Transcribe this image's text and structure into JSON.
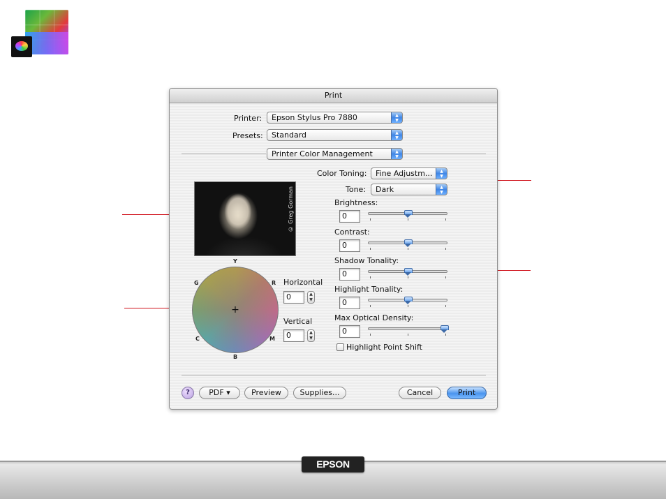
{
  "dialog": {
    "title": "Print",
    "printer_label": "Printer:",
    "printer_value": "Epson Stylus Pro 7880",
    "presets_label": "Presets:",
    "presets_value": "Standard",
    "panel_value": "Printer Color Management",
    "color_toning_label": "Color Toning:",
    "color_toning_value": "Fine Adjustm...",
    "tone_label": "Tone:",
    "tone_value": "Dark",
    "photo_credit": "© Greg Gorman",
    "wheel_labels": {
      "y": "Y",
      "r": "R",
      "m": "M",
      "b": "B",
      "c": "C",
      "g": "G"
    },
    "horizontal_label": "Horizontal",
    "horizontal_value": "0",
    "vertical_label": "Vertical",
    "vertical_value": "0",
    "sliders": [
      {
        "label": "Brightness:",
        "value": "0",
        "level": 0.5
      },
      {
        "label": "Contrast:",
        "value": "0",
        "level": 0.5
      },
      {
        "label": "Shadow Tonality:",
        "value": "0",
        "level": 0.5
      },
      {
        "label": "Highlight Tonality:",
        "value": "0",
        "level": 0.5
      },
      {
        "label": "Max Optical Density:",
        "value": "0",
        "level": 1.0
      }
    ],
    "highlight_point_shift_label": "Highlight Point Shift",
    "highlight_point_shift_checked": false,
    "help_label": "?",
    "pdf_label": "PDF ▾",
    "preview_label": "Preview",
    "supplies_label": "Supplies...",
    "cancel_label": "Cancel",
    "print_label": "Print"
  },
  "footer": {
    "brand": "EPSON"
  },
  "colors": {
    "callout": "#e0101a",
    "accent": "#4a94ee"
  },
  "icons": [
    "app-logo-icon",
    "popup-arrows-icon",
    "crosshair-icon",
    "help-icon",
    "stepper-icon"
  ]
}
